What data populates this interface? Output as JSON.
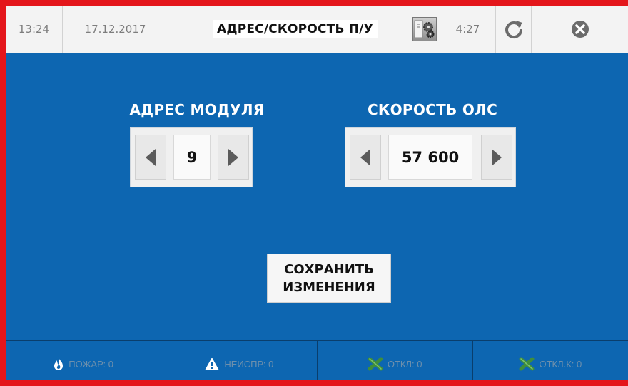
{
  "header": {
    "time": "13:24",
    "date": "17.12.2017",
    "title": "АДРЕС/СКОРОСТЬ П/У",
    "uptime": "4:27"
  },
  "module_address": {
    "label": "АДРЕС МОДУЛЯ",
    "value": "9"
  },
  "ols_speed": {
    "label": "СКОРОСТЬ ОЛС",
    "value": "57 600"
  },
  "save_button": {
    "line1": "СОХРАНИТЬ",
    "line2": "ИЗМЕНЕНИЯ"
  },
  "status_bar": {
    "fire": "ПОЖАР: 0",
    "fault": "НЕИСПР: 0",
    "disabled": "ОТКЛ: 0",
    "disabled_k": "ОТКЛ.К: 0"
  },
  "colors": {
    "frame": "#e4161b",
    "background": "#0d66b1",
    "header": "#f3f3f3",
    "status_icon_green": "#3f8e3c"
  }
}
